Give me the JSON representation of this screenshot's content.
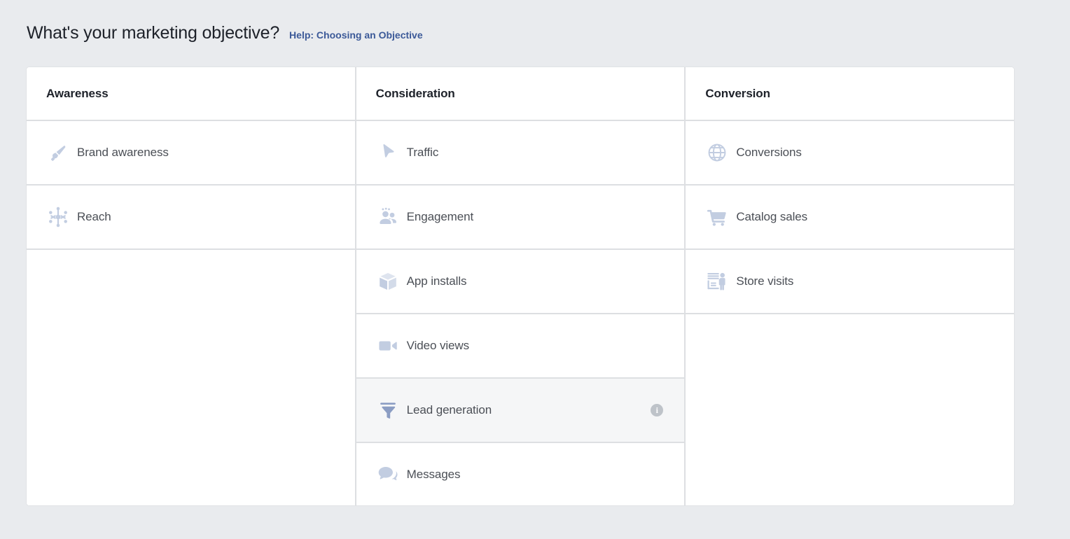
{
  "header": {
    "title": "What's your marketing objective?",
    "help_link": "Help: Choosing an Objective",
    "link_color": "#3b5998"
  },
  "theme": {
    "page_background": "#e9ebee",
    "card_background": "#ffffff",
    "border_color": "#dddfe2",
    "icon_color": "#c2cde1",
    "icon_color_selected": "#8b9dc3",
    "row_selected_background": "#f5f6f7",
    "label_color": "#4b4f56",
    "header_color": "#1d2129"
  },
  "columns": [
    {
      "header": "Awareness",
      "rows": [
        {
          "label": "Brand awareness",
          "icon": "megaphone-icon",
          "selected": false,
          "has_info": false
        },
        {
          "label": "Reach",
          "icon": "reach-hub-icon",
          "selected": false,
          "has_info": false
        }
      ]
    },
    {
      "header": "Consideration",
      "rows": [
        {
          "label": "Traffic",
          "icon": "cursor-arrow-icon",
          "selected": false,
          "has_info": false
        },
        {
          "label": "Engagement",
          "icon": "people-group-icon",
          "selected": false,
          "has_info": false
        },
        {
          "label": "App installs",
          "icon": "box-3d-icon",
          "selected": false,
          "has_info": false
        },
        {
          "label": "Video views",
          "icon": "video-camera-icon",
          "selected": false,
          "has_info": false
        },
        {
          "label": "Lead generation",
          "icon": "funnel-icon",
          "selected": true,
          "has_info": true,
          "info_label": "i"
        },
        {
          "label": "Messages",
          "icon": "chat-bubbles-icon",
          "selected": false,
          "has_info": false
        }
      ]
    },
    {
      "header": "Conversion",
      "rows": [
        {
          "label": "Conversions",
          "icon": "globe-icon",
          "selected": false,
          "has_info": false
        },
        {
          "label": "Catalog sales",
          "icon": "shopping-cart-icon",
          "selected": false,
          "has_info": false
        },
        {
          "label": "Store visits",
          "icon": "storefront-icon",
          "selected": false,
          "has_info": false
        }
      ]
    }
  ]
}
